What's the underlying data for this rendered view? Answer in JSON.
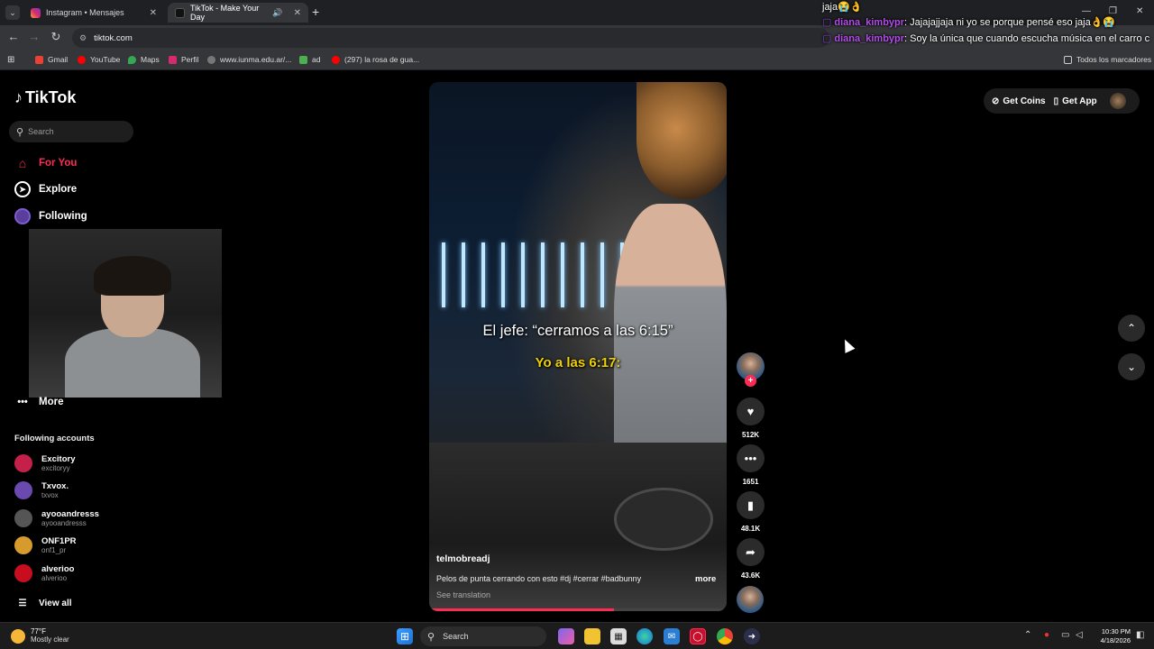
{
  "browser": {
    "tabs": [
      {
        "label": "Instagram • Mensajes",
        "close": "✕"
      },
      {
        "label": "TikTok - Make Your Day",
        "close": "✕"
      }
    ],
    "new_tab": "+",
    "url": "tiktok.com",
    "bookmarks": [
      "Gmail",
      "YouTube",
      "Maps",
      "Perfil",
      "www.iunma.edu.ar/...",
      "ad",
      "(297) la rosa de gua..."
    ],
    "bookmarks_right": "Todos los marcadores"
  },
  "chat_overlay": [
    {
      "user": "",
      "text": "jaja😭👌"
    },
    {
      "user": "diana_kimbypr",
      "text": ": Jajajajjaja ni yo se porque pensé eso jaja👌😭"
    },
    {
      "user": "diana_kimbypr",
      "text": ": Soy la única que cuando escucha música en el carro c"
    }
  ],
  "tiktok": {
    "logo": "TikTok",
    "search_placeholder": "Search",
    "nav": [
      {
        "label": "For You",
        "active": true
      },
      {
        "label": "Explore"
      },
      {
        "label": "Following"
      },
      {
        "label": "More"
      }
    ],
    "following_title": "Following accounts",
    "accounts": [
      {
        "name": "Excitory",
        "handle": "excitoryy",
        "color": "#c4204a"
      },
      {
        "name": "Txvox.",
        "handle": "txvox",
        "color": "#6b4ab0"
      },
      {
        "name": "ayooandresss",
        "handle": "ayooandresss",
        "color": "#555555"
      },
      {
        "name": "ONF1PR",
        "handle": "onf1_pr",
        "color": "#d79a2c"
      },
      {
        "name": "alverioo",
        "handle": "alverioo",
        "color": "#c80d1e"
      }
    ],
    "view_all": "View all",
    "top_right": {
      "coins": "Get Coins",
      "app": "Get App"
    }
  },
  "video": {
    "caption_line1": "El jefe: “cerramos a las 6:15”",
    "caption_line2": "Yo a las 6:17:",
    "username": "telmobreadj",
    "description": "Pelos de punta cerrando con esto #dj #cerrar #badbunny",
    "more": "more",
    "see_translation": "See translation",
    "progress": 0.62,
    "accent": "#fe2c55"
  },
  "actions": {
    "likes": "512K",
    "comments": "1651",
    "saves": "48.1K",
    "shares": "43.6K"
  },
  "taskbar": {
    "temp": "77°F",
    "condition": "Mostly clear",
    "search": "Search",
    "time": "10:30 PM",
    "date": "4/18/2026"
  }
}
